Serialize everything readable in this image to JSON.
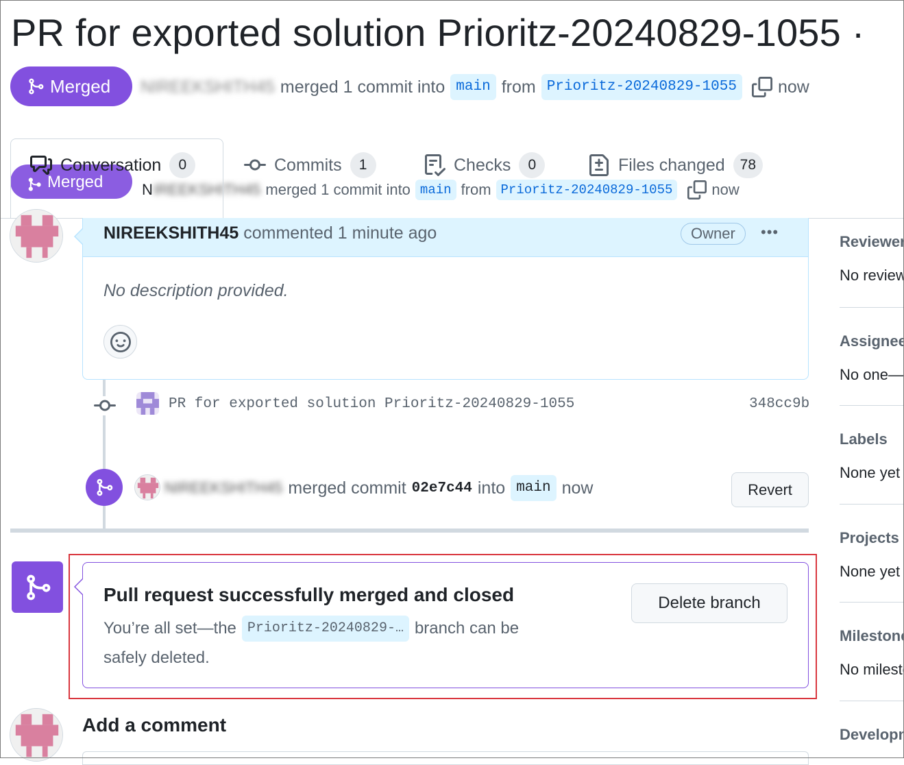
{
  "pr": {
    "title": "PR for exported solution Prioritz-20240829-1055 ·",
    "state_label": "Merged",
    "author_blurred": "NIREEKSHITH45",
    "merged_text": "merged 1 commit into",
    "base_branch": "main",
    "from_text": "from",
    "head_branch": "Prioritz-20240829-1055",
    "time": "now"
  },
  "tabs": [
    {
      "label": "Conversation",
      "count": "0"
    },
    {
      "label": "Commits",
      "count": "1"
    },
    {
      "label": "Checks",
      "count": "0"
    },
    {
      "label": "Files changed",
      "count": "78"
    }
  ],
  "sticky": {
    "state_label": "Merged",
    "author_initial": "N",
    "author_blurred": "IREEKSHITH45",
    "merged_text": "merged 1 commit into",
    "base_branch": "main",
    "from_text": "from",
    "head_branch": "Prioritz-20240829-1055",
    "time": "now"
  },
  "comment": {
    "author": "NIREEKSHITH45",
    "action": "commented 1 minute ago",
    "role": "Owner",
    "menu": "•••",
    "body": "No description provided."
  },
  "commit": {
    "message": "PR for exported solution Prioritz-20240829-1055",
    "sha": "348cc9b"
  },
  "merge_event": {
    "author_blurred": "NIREEKSHITH45",
    "text": "merged commit",
    "sha": "02e7c44",
    "into_text": "into",
    "branch": "main",
    "time": "now",
    "revert_label": "Revert"
  },
  "merged_box": {
    "heading": "Pull request successfully merged and closed",
    "desc_before": "You’re all set—the",
    "branch": "Prioritz-20240829-…",
    "desc_after": "branch can be",
    "desc_line2": "safely deleted.",
    "delete_label": "Delete branch"
  },
  "add_comment": {
    "heading": "Add a comment"
  },
  "sidebar": [
    {
      "title": "Reviewers",
      "value": "No reviews"
    },
    {
      "title": "Assignees",
      "value": "No one—"
    },
    {
      "title": "Labels",
      "value": "None yet"
    },
    {
      "title": "Projects",
      "value": "None yet"
    },
    {
      "title": "Milestone",
      "value": "No milestone"
    },
    {
      "title": "Development",
      "value": ""
    }
  ],
  "colors": {
    "merged_purple": "#8250df",
    "link_blue": "#0969da",
    "branch_bg": "#ddf4ff",
    "highlight_red": "#d9363e"
  }
}
